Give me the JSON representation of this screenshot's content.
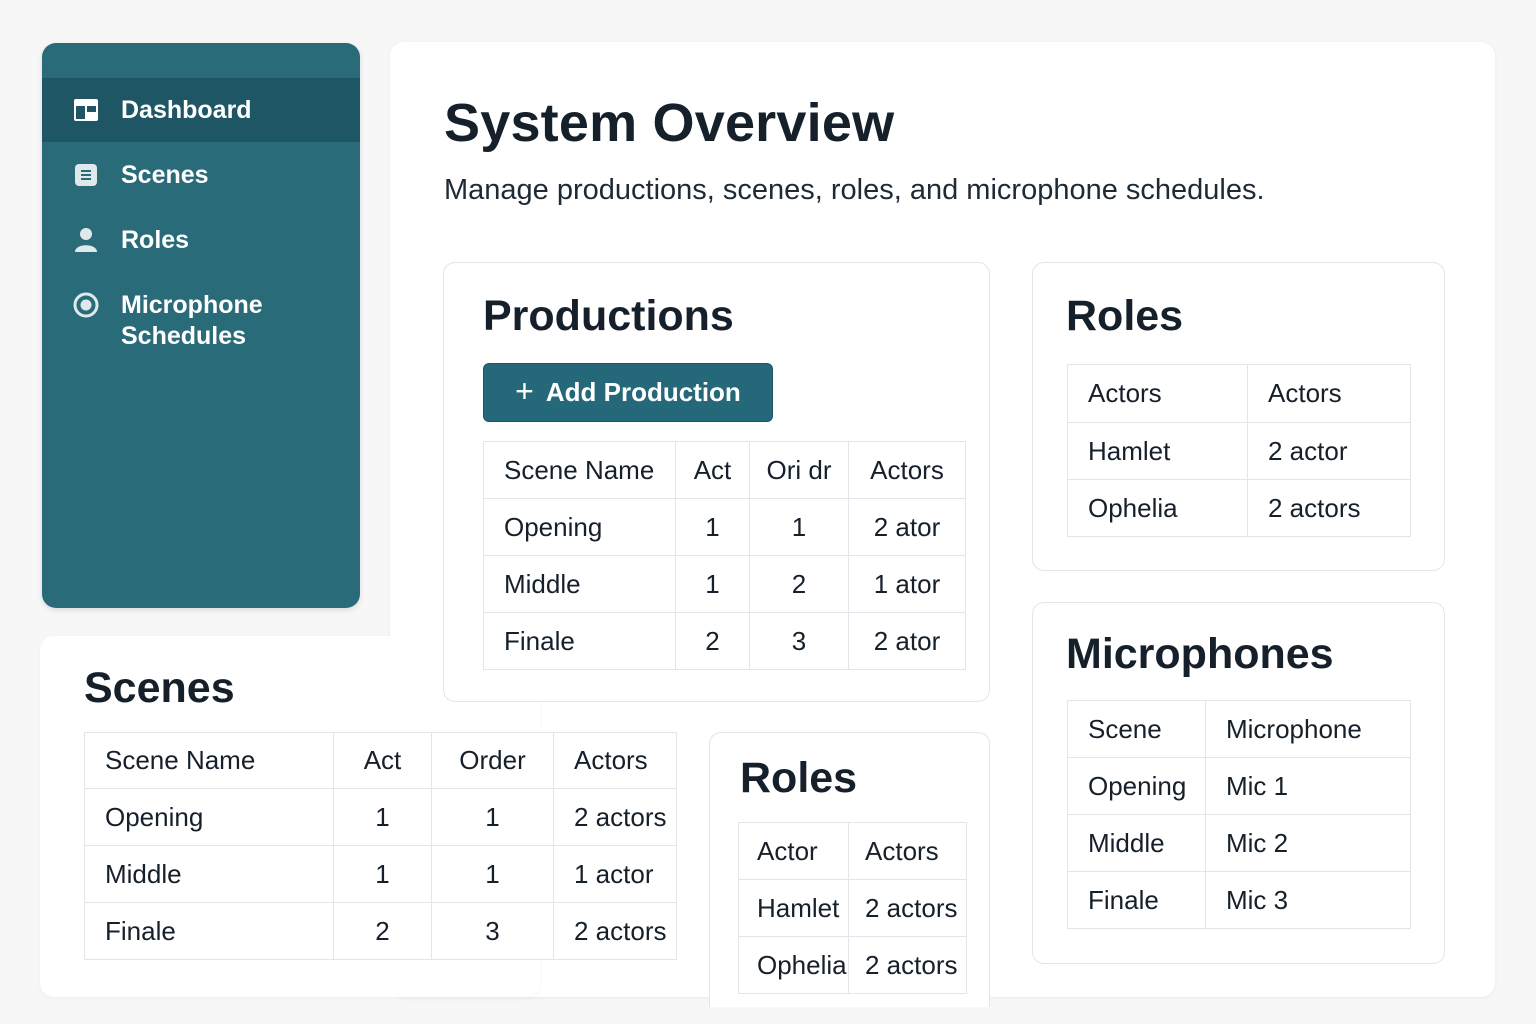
{
  "sidebar": {
    "items": [
      {
        "label": "Dashboard",
        "icon": "dashboard-icon",
        "active": true
      },
      {
        "label": "Scenes",
        "icon": "list-icon",
        "active": false
      },
      {
        "label": "Roles",
        "icon": "user-icon",
        "active": false
      },
      {
        "label": "Microphone Schedules",
        "label_line1": "Microphone",
        "label_line2": "Schedules",
        "icon": "microphone-icon",
        "active": false
      }
    ]
  },
  "header": {
    "title": "System Overview",
    "subtitle": "Manage productions, scenes, roles, and microphone schedules."
  },
  "productions": {
    "title": "Productions",
    "add_button": "Add Production",
    "columns": [
      "Scene Name",
      "Act",
      "Ori dr",
      "Actors"
    ],
    "rows": [
      [
        "Opening",
        "1",
        "1",
        "2 ator"
      ],
      [
        "Middle",
        "1",
        "2",
        "1 ator"
      ],
      [
        "Finale",
        "2",
        "3",
        "2 ator"
      ]
    ]
  },
  "roles_top": {
    "title": "Roles",
    "columns": [
      "Actors",
      "Actors"
    ],
    "rows": [
      [
        "Hamlet",
        "2 actor"
      ],
      [
        "Ophelia",
        "2 actors"
      ]
    ]
  },
  "microphones": {
    "title": "Microphones",
    "columns": [
      "Scene",
      "Microphone"
    ],
    "rows": [
      [
        "Opening",
        "Mic 1"
      ],
      [
        "Middle",
        "Mic 2"
      ],
      [
        "Finale",
        "Mic 3"
      ]
    ]
  },
  "scenes": {
    "title": "Scenes",
    "columns": [
      "Scene Name",
      "Act",
      "Order",
      "Actors"
    ],
    "rows": [
      [
        "Opening",
        "1",
        "1",
        "2 actors"
      ],
      [
        "Middle",
        "1",
        "1",
        "1 actor"
      ],
      [
        "Finale",
        "2",
        "3",
        "2 actors"
      ]
    ]
  },
  "roles_bottom": {
    "title": "Roles",
    "columns": [
      "Actor",
      "Actors"
    ],
    "rows": [
      [
        "Hamlet",
        "2 actors"
      ],
      [
        "Ophelia",
        "2 actors"
      ]
    ]
  },
  "colors": {
    "sidebar_bg": "#2a6b7a",
    "sidebar_active": "#1f5666",
    "button_bg": "#24687a",
    "text": "#16202b",
    "border": "#e2e5e9"
  }
}
